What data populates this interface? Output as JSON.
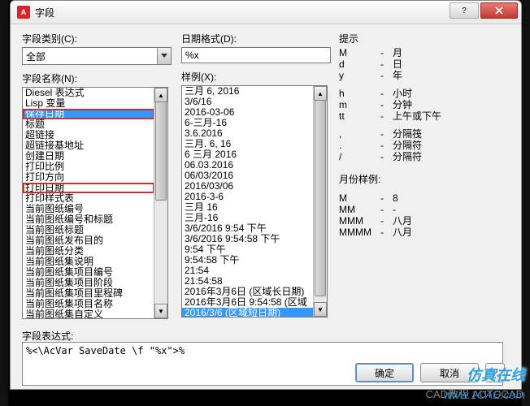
{
  "window": {
    "app_icon_letter": "A",
    "title": "字段"
  },
  "labels": {
    "field_category": "字段类别(C):",
    "field_name": "字段名称(N):",
    "date_format": "日期格式(D):",
    "sample": "样例(X):",
    "expression": "字段表达式:",
    "hints_title": "提示"
  },
  "field_category_value": "全部",
  "date_format_value": "%x",
  "field_names": [
    "Diesel 表达式",
    "Lisp 变量",
    "保存日期",
    "标题",
    "超链接",
    "超链接基地址",
    "创建日期",
    "打印比例",
    "打印方向",
    "打印日期",
    "打印样式表",
    "当前图纸编号",
    "当前图纸编号和标题",
    "当前图纸标题",
    "当前图纸发布目的",
    "当前图纸分类",
    "当前图纸集说明",
    "当前图纸集项目编号",
    "当前图纸集项目阶段",
    "当前图纸集项目里程碑",
    "当前图纸集项目名称",
    "当前图纸集自定义"
  ],
  "field_names_selected_index": 2,
  "field_names_boxed_indices": [
    2,
    9
  ],
  "samples": [
    "三月 6, 2016",
    "3/6/16",
    "2016-03-06",
    "6-三月-16",
    "3.6.2016",
    "三月. 6, 16",
    "6 三月 2016",
    "06.03.2016",
    "06/03/2016",
    "2016/03/06",
    "2016-3-6",
    "三月 16",
    "三月-16",
    "3/6/2016 9:54 下午",
    "3/6/2016 9:54:58 下午",
    "9:54 下午",
    "9:54:58 下午",
    "21:54",
    "21:54:58",
    "2016年3月6日  (区域长日期)",
    "2016年3月6日 9:54:58  (区域",
    "2016/3/6  (区域短日期)"
  ],
  "samples_selected_index": 21,
  "hints": [
    {
      "k": "M",
      "v": "月"
    },
    {
      "k": "d",
      "v": "日"
    },
    {
      "k": "y",
      "v": "年"
    }
  ],
  "hints2": [
    {
      "k": "h",
      "v": "小时"
    },
    {
      "k": "m",
      "v": "分钟"
    },
    {
      "k": "tt",
      "v": "上午或下午"
    }
  ],
  "hints3": [
    {
      "k": ",",
      "v": "分隔筏"
    },
    {
      "k": ".",
      "v": "分隔符"
    },
    {
      "k": "/",
      "v": "分隔符"
    }
  ],
  "month_sample_label": "月份样例:",
  "month_samples": [
    {
      "k": "M",
      "v": "8"
    },
    {
      "k": "MM",
      "v": "-"
    },
    {
      "k": "MMM",
      "v": "八月"
    },
    {
      "k": "MMMM",
      "v": "八月"
    }
  ],
  "expression_value": "%<\\AcVar SaveDate \\f \"%x\">%",
  "buttons": {
    "ok": "确定",
    "cancel": "取消",
    "help": "?"
  },
  "watermark": "CAD教程 AUTOCAD",
  "brand": "仿真在线",
  "brand_url": "www.1CAE.com"
}
